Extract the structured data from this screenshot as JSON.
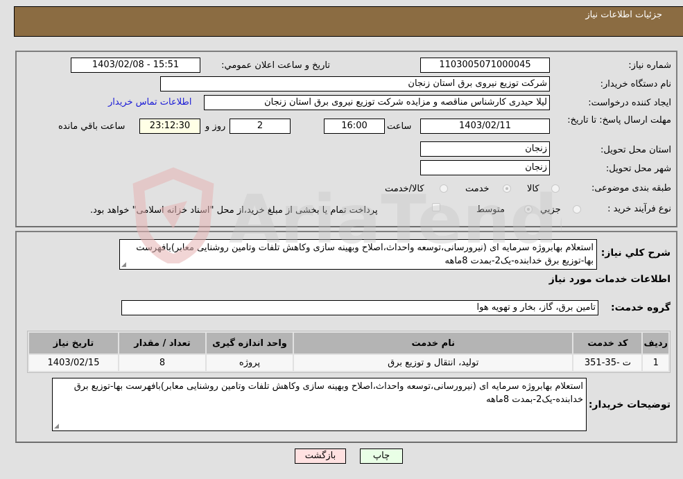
{
  "header": {
    "title": "جزئیات اطلاعات نیاز"
  },
  "colors": {
    "header_bg": "#8b6c42",
    "link": "#1a1ad6",
    "print_button_bg": "#e9ffe6",
    "back_button_bg": "#ffe1e1",
    "remaining_time_bg": "#ffffe6"
  },
  "fields": {
    "need_number_label": "شماره نیاز:",
    "need_number": "1103005071000045",
    "announce_label": "تاریخ و ساعت اعلان عمومي:",
    "announce_value": "1403/02/08 - 15:51",
    "buyer_org_label": "نام دستگاه خریدار:",
    "buyer_org": "شرکت توزیع نیروی برق استان زنجان",
    "creator_label": "ایجاد کننده درخواست:",
    "creator": "لیلا حیدری کارشناس مناقصه و مزایده شرکت توزیع نیروی برق استان زنجان",
    "buyer_contact_link": "اطلاعات تماس خریدار",
    "deadline_label": "مهلت ارسال پاسخ: تا تاریخ:",
    "deadline_date": "1403/02/11",
    "time_label": "ساعت",
    "deadline_time": "16:00",
    "days_value": "2",
    "days_label": "روز و",
    "remaining_time": "23:12:30",
    "remaining_label": "ساعت باقي مانده",
    "province_label": "استان محل تحویل:",
    "province": "زنجان",
    "city_label": "شهر محل تحویل:",
    "city": "زنجان",
    "category_label": "طبقه بندی موضوعی:",
    "category_options": [
      {
        "label": "کالا",
        "checked": false
      },
      {
        "label": "خدمت",
        "checked": true
      },
      {
        "label": "کالا/خدمت",
        "checked": false
      }
    ],
    "purchase_type_label": "نوع فرآیند خرید :",
    "purchase_type_options": [
      {
        "label": "جزيي",
        "checked": false
      },
      {
        "label": "متوسط",
        "checked": true
      }
    ],
    "treasury_note": "پرداخت تمام یا بخشی از مبلغ خرید،از محل \"اسناد خزانه اسلامی\" خواهد بود.",
    "treasury_checked": false
  },
  "description": {
    "label": "شرح کلي نیاز:",
    "text": "استعلام بهابروژه سرمایه ای (نیرورسانی،توسعه واحداث،اصلاح وبهینه سازی وکاهش تلفات وتامین روشنایی معابر)بافهرست بها-توزیع برق خدابنده-یک2-بمدت 8ماهه"
  },
  "services": {
    "section_title": "اطلاعات خدمات مورد نیاز",
    "group_label": "گروه خدمت:",
    "group_value": "تامین برق، گاز، بخار و تهویه هوا",
    "table": {
      "columns": [
        "ردیف",
        "کد خدمت",
        "نام خدمت",
        "واحد اندازه گیری",
        "تعداد / مقدار",
        "تاریخ نیاز"
      ],
      "rows": [
        [
          "1",
          "ت -35-351",
          "تولید، انتقال و توزیع برق",
          "پروژه",
          "8",
          "1403/02/15"
        ]
      ]
    }
  },
  "buyer_notes": {
    "label": "توضیحات خریدار:",
    "text": "استعلام بهابروژه سرمایه ای (نیرورسانی،توسعه واحداث،اصلاح وبهینه سازی وکاهش تلفات وتامین روشنایی معابر)بافهرست بها-توزیع برق خدابنده-یک2-بمدت 8ماهه"
  },
  "buttons": {
    "print": "چاپ",
    "back": "بازگشت"
  },
  "watermark": {
    "text": "AriaTender.neT"
  }
}
